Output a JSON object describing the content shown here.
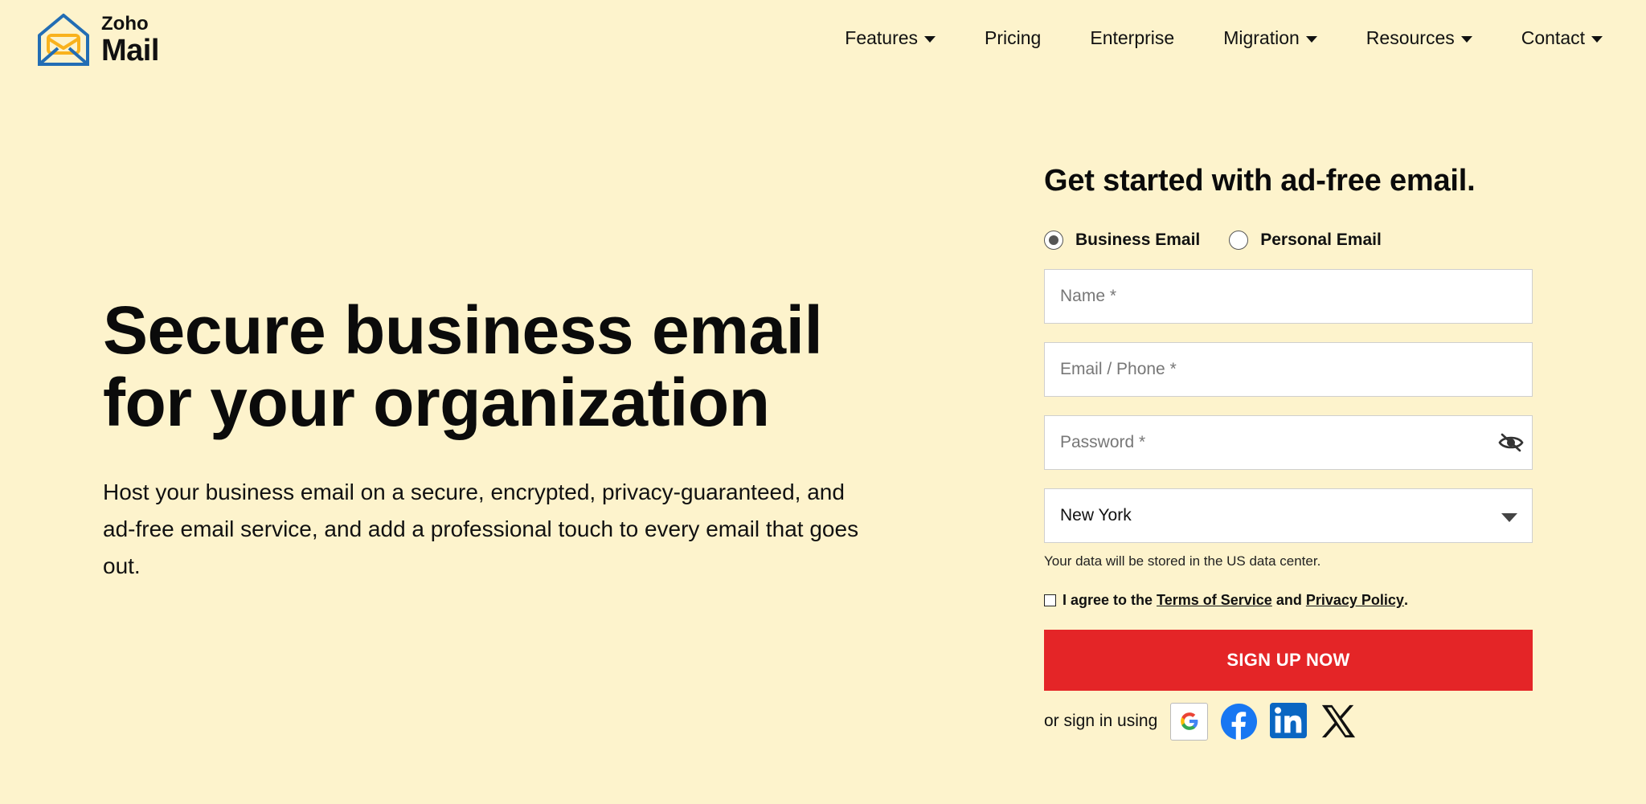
{
  "brand": {
    "top": "Zoho",
    "bottom": "Mail"
  },
  "nav": {
    "features": "Features",
    "pricing": "Pricing",
    "enterprise": "Enterprise",
    "migration": "Migration",
    "resources": "Resources",
    "contact": "Contact"
  },
  "hero": {
    "title_line1": "Secure business email",
    "title_line2": "for your organization",
    "description": "Host your business email on a secure, encrypted, privacy-guaranteed, and ad-free email service, and add a professional touch to every email that goes out."
  },
  "form": {
    "title": "Get started with ad-free email.",
    "radio_business": "Business Email",
    "radio_personal": "Personal Email",
    "selected_radio": "Business Email",
    "name_placeholder": "Name *",
    "email_placeholder": "Email / Phone *",
    "password_placeholder": "Password *",
    "region_value": "New York",
    "data_center_note": "Your data will be stored in the US data center.",
    "agree_prefix": "I agree to the",
    "terms_link": "Terms of Service",
    "agree_and": "and",
    "privacy_link": "Privacy Policy",
    "agree_suffix": ".",
    "signup_button": "SIGN UP NOW",
    "sign_in_using": "or sign in using"
  },
  "icons": {
    "logo": "zoho-mail-logo-icon",
    "password_toggle": "eye-slash-icon",
    "google": "google-icon",
    "facebook": "facebook-icon",
    "linkedin": "linkedin-icon",
    "x": "x-icon"
  },
  "colors": {
    "background": "#fdf3cc",
    "cta": "#e42527",
    "logo_blue": "#226db4",
    "logo_yellow": "#f9b21d",
    "facebook": "#1877f2",
    "linkedin": "#0a66c2"
  }
}
